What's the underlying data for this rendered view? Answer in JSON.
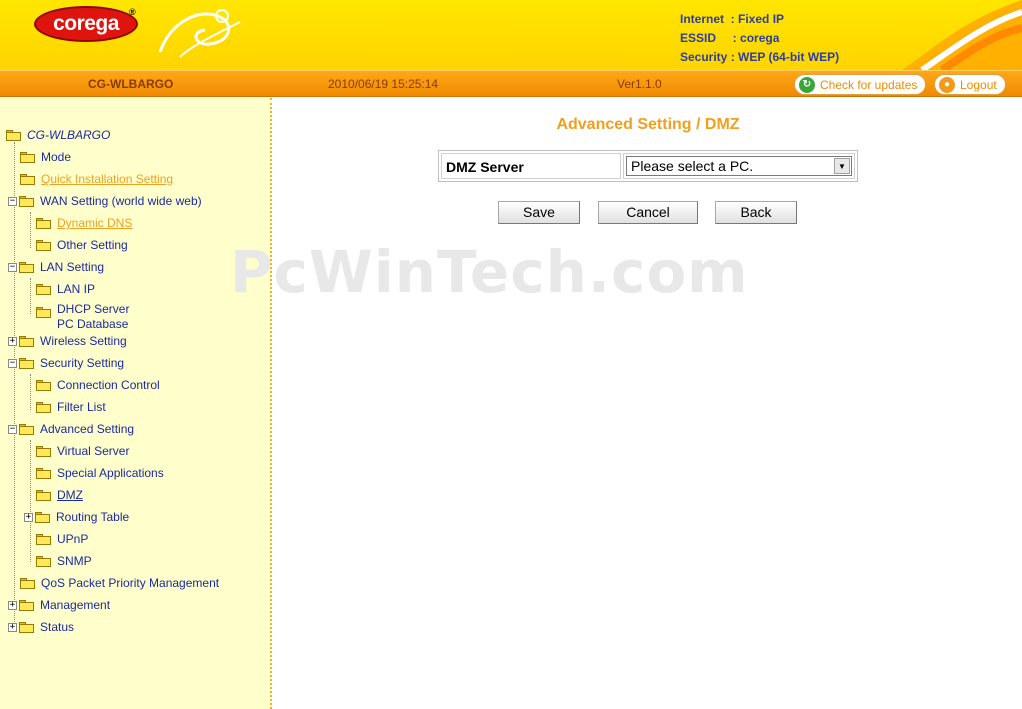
{
  "header": {
    "logo_text": "corega",
    "logo_reg": "®",
    "status": [
      {
        "label": "Internet  : ",
        "value": "Fixed IP"
      },
      {
        "label": "ESSID     : ",
        "value": "corega"
      },
      {
        "label": "Security : ",
        "value": "WEP (64-bit WEP)"
      }
    ]
  },
  "topbar": {
    "model": "CG-WLBARGO",
    "datetime": "2010/06/19 15:25:14",
    "version": "Ver1.1.0",
    "check_updates": "Check for updates",
    "logout": "Logout"
  },
  "sidebar": {
    "root": "CG-WLBARGO",
    "items": [
      {
        "label": "Mode",
        "expander": ""
      },
      {
        "label": "Quick Installation Setting",
        "expander": ""
      },
      {
        "label": "WAN Setting (world wide web)",
        "expander": "−"
      },
      {
        "label": "Dynamic DNS",
        "expander": ""
      },
      {
        "label": "Other Setting",
        "expander": ""
      },
      {
        "label": "LAN Setting",
        "expander": "−"
      },
      {
        "label": "LAN IP",
        "expander": ""
      },
      {
        "label": "DHCP Server",
        "expander": ""
      },
      {
        "label": "PC Database",
        "expander": ""
      },
      {
        "label": "Wireless Setting",
        "expander": "+"
      },
      {
        "label": "Security Setting",
        "expander": "−"
      },
      {
        "label": "Connection Control",
        "expander": ""
      },
      {
        "label": "Filter List",
        "expander": ""
      },
      {
        "label": "Advanced Setting",
        "expander": "−"
      },
      {
        "label": "Virtual Server",
        "expander": ""
      },
      {
        "label": "Special Applications",
        "expander": ""
      },
      {
        "label": "DMZ",
        "expander": ""
      },
      {
        "label": "Routing Table",
        "expander": "+"
      },
      {
        "label": "UPnP",
        "expander": ""
      },
      {
        "label": "SNMP",
        "expander": ""
      },
      {
        "label": "QoS Packet Priority Management",
        "expander": ""
      },
      {
        "label": "Management",
        "expander": "+"
      },
      {
        "label": "Status",
        "expander": "+"
      }
    ]
  },
  "main": {
    "title": "Advanced Setting / DMZ",
    "dmz_label": "DMZ Server",
    "dmz_select_value": "Please select a PC.",
    "buttons": {
      "save": "Save",
      "cancel": "Cancel",
      "back": "Back"
    }
  },
  "watermark": "PcWinTech.com",
  "colors": {
    "accent_orange": "#f0a020",
    "link_blue": "#1a2aa0",
    "header_yellow": "#ffe600",
    "sidebar_bg": "#ffffcc"
  }
}
